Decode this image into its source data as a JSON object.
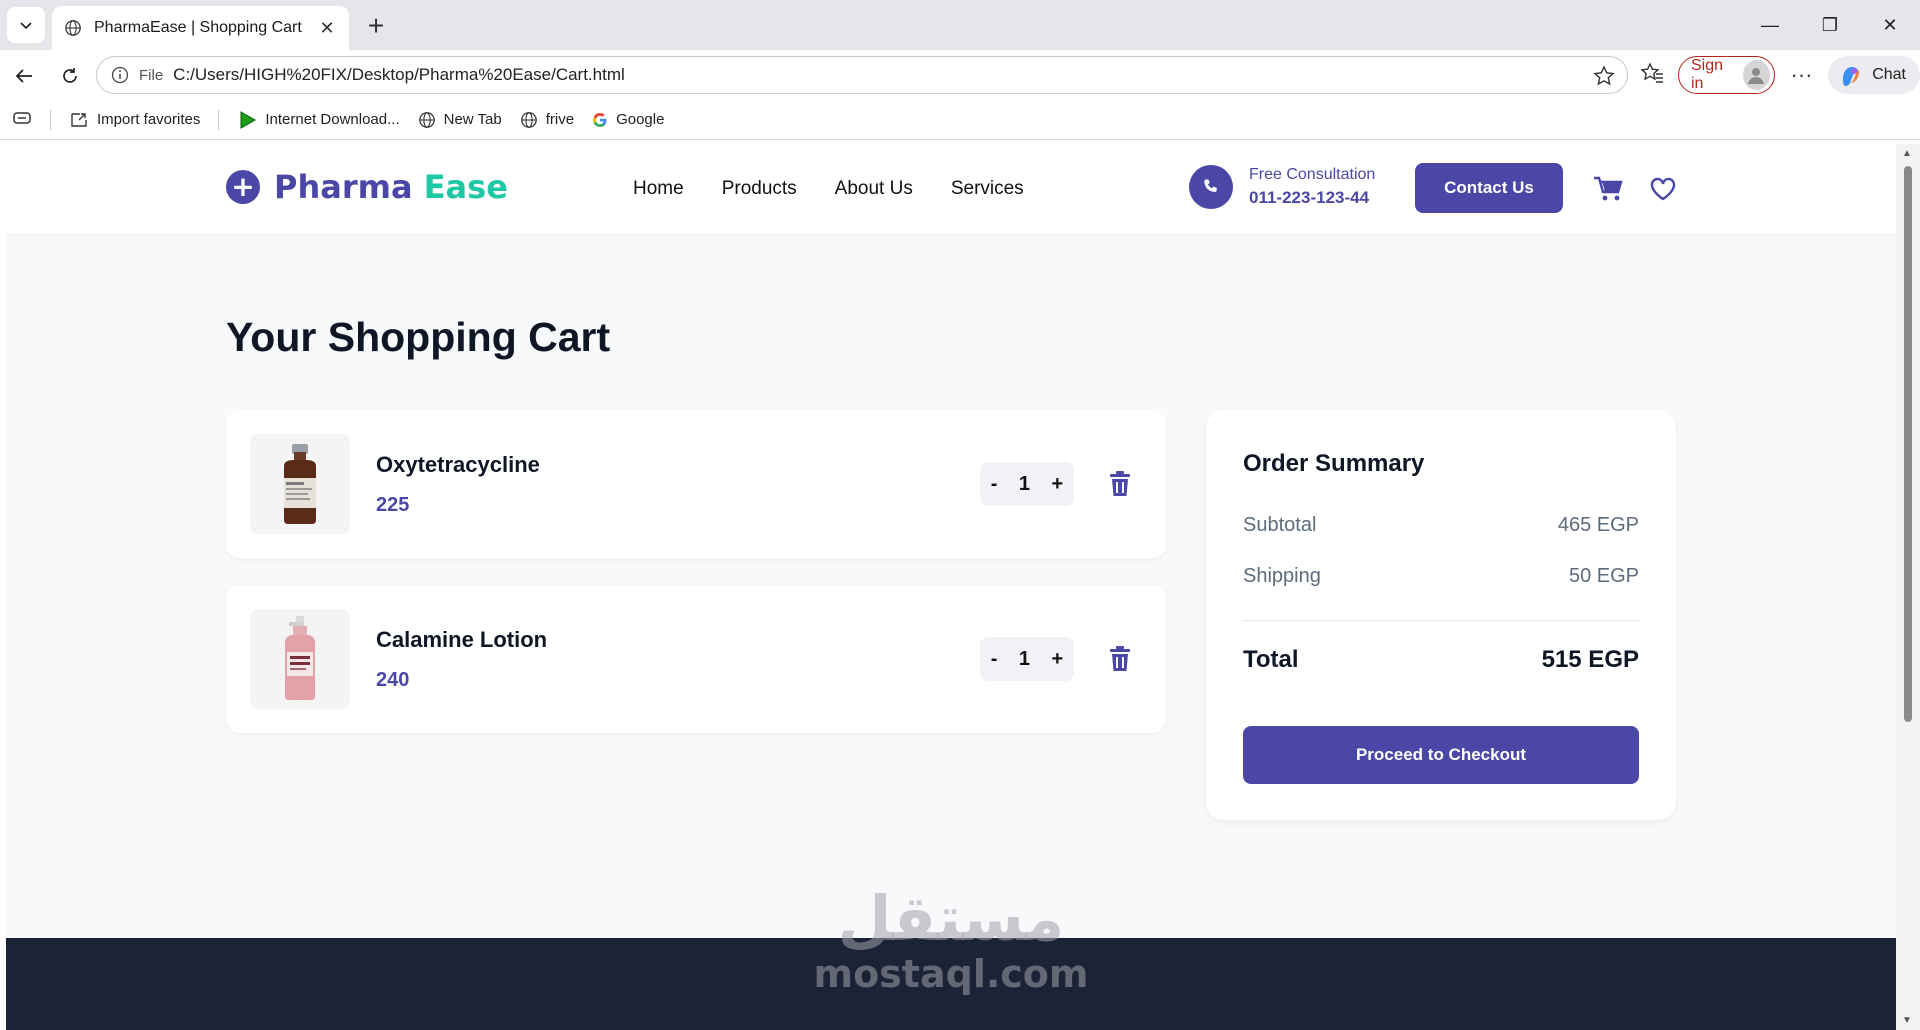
{
  "browser": {
    "tab_title": "PharmaEase | Shopping Cart",
    "omnibox_file": "File",
    "url": "C:/Users/HIGH%20FIX/Desktop/Pharma%20Ease/Cart.html",
    "signin_label": "Sign in",
    "chat_label": "Chat",
    "favorites": [
      "Import favorites",
      "Internet Download...",
      "New Tab",
      "frive",
      "Google"
    ]
  },
  "header": {
    "logo_part1": "Pharma",
    "logo_part2": "Ease",
    "nav": [
      "Home",
      "Products",
      "About Us",
      "Services"
    ],
    "consult_label": "Free Consultation",
    "consult_phone": "011-223-123-44",
    "contact_label": "Contact Us"
  },
  "cart": {
    "title": "Your Shopping Cart",
    "items": [
      {
        "name": "Oxytetracycline",
        "price": "225",
        "qty": "1"
      },
      {
        "name": "Calamine Lotion",
        "price": "240",
        "qty": "1"
      }
    ],
    "minus": "-",
    "plus": "+"
  },
  "summary": {
    "title": "Order Summary",
    "subtotal_label": "Subtotal",
    "subtotal_value": "465 EGP",
    "shipping_label": "Shipping",
    "shipping_value": "50 EGP",
    "total_label": "Total",
    "total_value": "515 EGP",
    "checkout_label": "Proceed to Checkout"
  },
  "watermark": {
    "arabic": "مستقل",
    "latin": "mostaql.com"
  },
  "colors": {
    "brand": "#4b47a6",
    "accent": "#1fc8a5",
    "footer": "#1b2437"
  }
}
